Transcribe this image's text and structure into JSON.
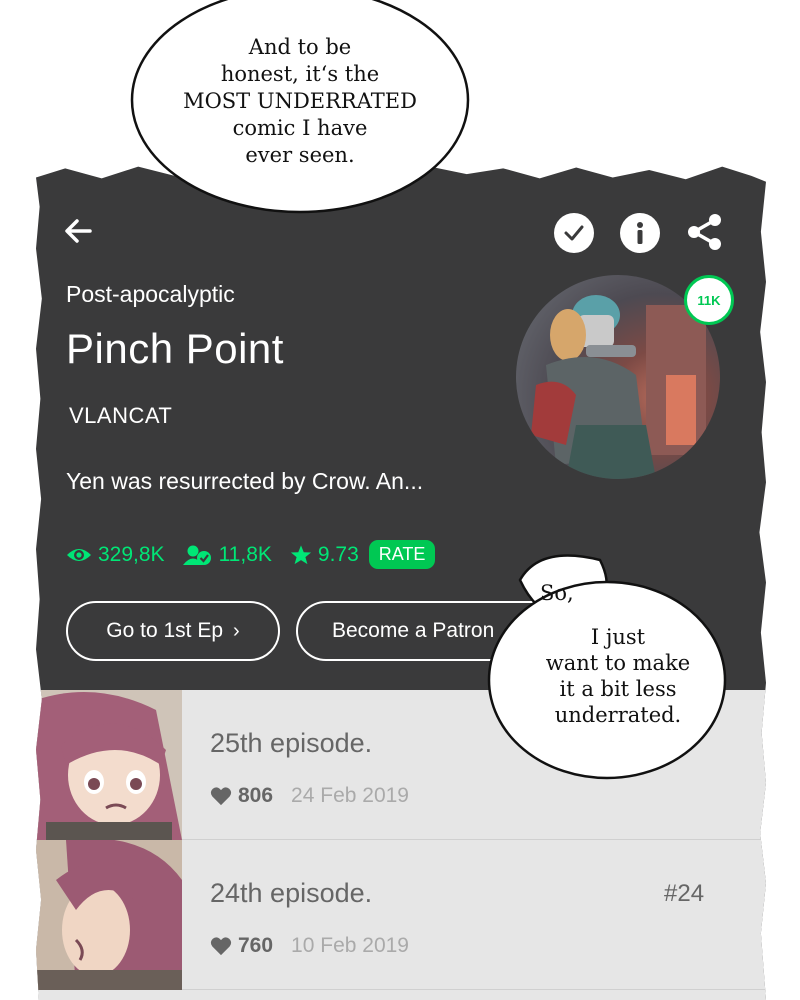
{
  "header": {
    "back_icon": "arrow-left-icon",
    "actions": [
      "check-icon",
      "info-icon",
      "share-icon"
    ]
  },
  "comic": {
    "genre": "Post-apocalyptic",
    "title": "Pinch Point",
    "author": "VLANCAT",
    "description": "Yen was resurrected by Crow. An...",
    "subscriber_badge": "11K"
  },
  "stats": {
    "views": "329,8K",
    "subscribers": "11,8K",
    "rating": "9.73",
    "rate_label": "RATE"
  },
  "buttons": {
    "first_episode": "Go to 1st Ep",
    "become_patron": "Become a Patron"
  },
  "episodes": [
    {
      "title": "25th episode.",
      "number": "",
      "likes": "806",
      "date": "24 Feb 2019"
    },
    {
      "title": "24th episode.",
      "number": "#24",
      "likes": "760",
      "date": "10 Feb 2019"
    }
  ],
  "bubbles": {
    "top": [
      "And to be",
      "honest, it‘s the",
      "MOST UNDERRATED",
      "comic I have",
      "ever seen."
    ],
    "bottom_lead": "So,",
    "bottom": [
      "I just",
      "want to make",
      "it a bit less",
      "underrated."
    ]
  },
  "colors": {
    "panel": "#3a3a3b",
    "accent": "#00c853",
    "stat_text": "#00e676",
    "list_bg": "#e6e6e6"
  }
}
